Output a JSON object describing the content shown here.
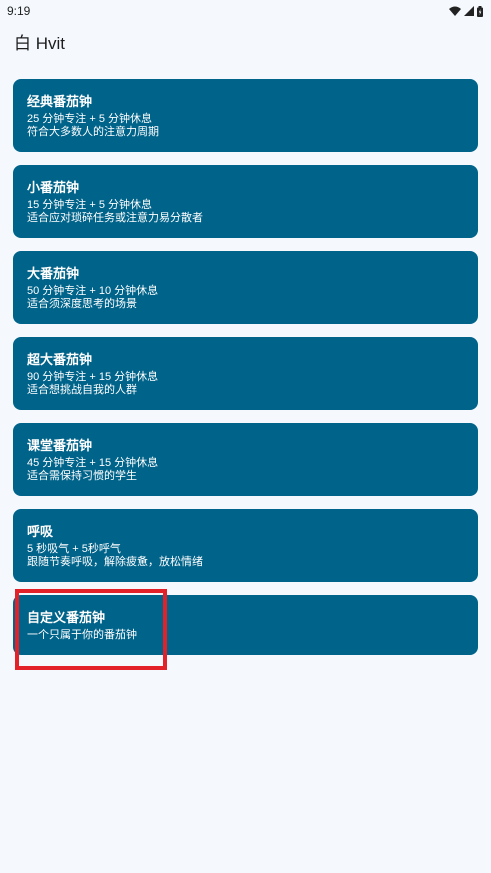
{
  "status_bar": {
    "time": "9:19",
    "icons": [
      "wifi-icon",
      "cellular-signal-icon",
      "battery-icon"
    ]
  },
  "app_bar": {
    "title": "白 Hvit"
  },
  "cards": [
    {
      "title": "经典番茄钟",
      "line1": "25 分钟专注 + 5 分钟休息",
      "line2": "符合大多数人的注意力周期"
    },
    {
      "title": "小番茄钟",
      "line1": "15 分钟专注 + 5 分钟休息",
      "line2": "适合应对琐碎任务或注意力易分散者"
    },
    {
      "title": "大番茄钟",
      "line1": "50 分钟专注 + 10 分钟休息",
      "line2": "适合须深度思考的场景"
    },
    {
      "title": "超大番茄钟",
      "line1": "90 分钟专注 + 15 分钟休息",
      "line2": "适合想挑战自我的人群"
    },
    {
      "title": "课堂番茄钟",
      "line1": "45 分钟专注 + 15 分钟休息",
      "line2": "适合需保持习惯的学生"
    },
    {
      "title": "呼吸",
      "line1": "5 秒吸气 + 5秒呼气",
      "line2": "跟随节奏呼吸，解除疲惫，放松情绪"
    },
    {
      "title": "自定义番茄钟",
      "line1": "一个只属于你的番茄钟"
    }
  ],
  "colors": {
    "background": "#f5f9fe",
    "card": "#00638a",
    "card_text": "#ffffff",
    "highlight": "#e32129"
  }
}
